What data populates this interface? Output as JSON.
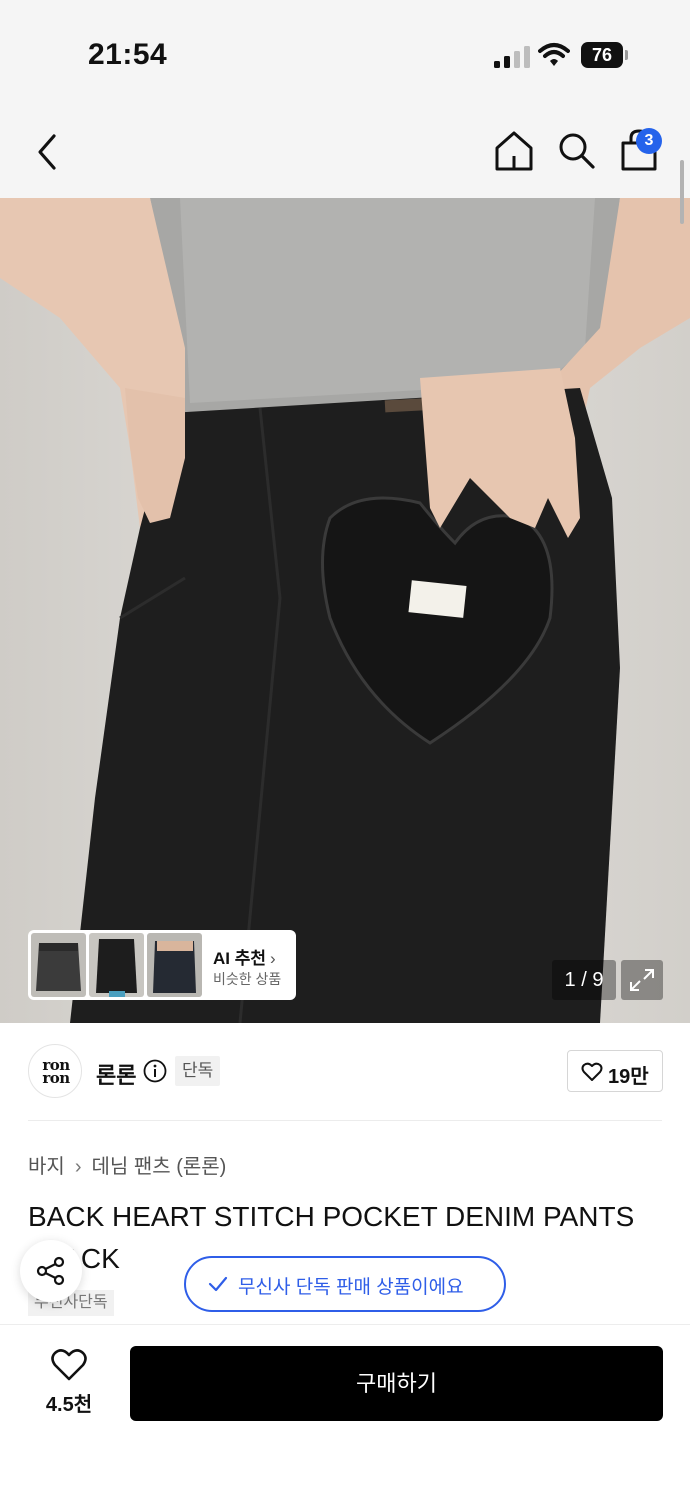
{
  "status": {
    "time": "21:54",
    "battery": "76"
  },
  "nav": {
    "cart_badge": "3"
  },
  "gallery": {
    "counter": "1 / 9",
    "ai_title": "AI 추천",
    "ai_subtitle": "비슷한 상품"
  },
  "brand": {
    "logo_line1": "ron",
    "logo_line2": "ron",
    "name": "론론",
    "exclusive": "단독",
    "likes": "19만"
  },
  "product": {
    "breadcrumb": [
      "바지",
      "데님 팬츠 (론론)"
    ],
    "title": "BACK HEART STITCH POCKET DENIM PANTS BLACK",
    "tag": "무신사단독"
  },
  "toast": {
    "text": "무신사 단독 판매 상품이에요"
  },
  "bottom": {
    "wish_count": "4.5천",
    "buy_label": "구매하기"
  },
  "colors": {
    "accent_blue": "#2f5ee8",
    "badge_blue": "#2563eb",
    "buy_black": "#000000"
  }
}
